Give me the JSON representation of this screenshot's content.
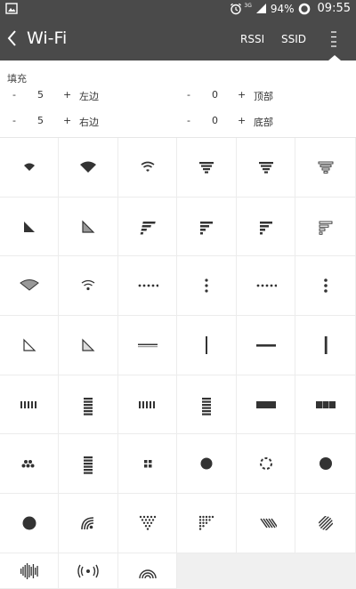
{
  "status_bar": {
    "battery_percent": "94%",
    "time": "09:55",
    "network_label": "3G"
  },
  "app_bar": {
    "title": "Wi-Fi",
    "action_rssi": "RSSI",
    "action_ssid": "SSID"
  },
  "padding": {
    "title": "填充",
    "left": {
      "minus": "-",
      "value": "5",
      "plus": "+",
      "label": "左边"
    },
    "top": {
      "minus": "-",
      "value": "0",
      "plus": "+",
      "label": "顶部"
    },
    "right": {
      "minus": "-",
      "value": "5",
      "plus": "+",
      "label": "右边"
    },
    "bottom": {
      "minus": "-",
      "value": "0",
      "plus": "+",
      "label": "底部"
    }
  },
  "styles": [
    "wifi-fan-small-icon",
    "wifi-fan-large-icon",
    "wifi-arcs-icon",
    "wifi-bars-funnel-icon",
    "wifi-bars-funnel-bold-icon",
    "wifi-bars-funnel-outline-icon",
    "signal-triangle-solid-icon",
    "signal-triangle-partial-icon",
    "signal-bars-slant-icon",
    "signal-bars-left-icon",
    "signal-bars-left-bold-icon",
    "signal-bars-left-outline-icon",
    "wifi-fan-outline-icon",
    "wifi-arcs-thin-icon",
    "dots-horizontal-icon",
    "dots-vertical-icon",
    "dots-horizontal-dark-icon",
    "dots-vertical-dark-icon",
    "signal-triangle-outline-icon",
    "signal-triangle-outline-partial-icon",
    "line-horizontal-thin-icon",
    "line-vertical-icon",
    "line-horizontal-bold-icon",
    "line-vertical-bold-icon",
    "bars-vertical-icon",
    "bars-stacked-icon",
    "bars-vertical-light-icon",
    "bars-stacked-bold-icon",
    "block-horizontal-icon",
    "block-segments-icon",
    "dots-triangle-icon",
    "bars-stacked-round-icon",
    "dots-square-icon",
    "circle-filled-icon",
    "circle-dashed-icon",
    "circle-filled-dark-icon",
    "circle-large-icon",
    "wifi-corner-arcs-icon",
    "dots-inverted-triangle-icon",
    "dots-corner-triangle-icon",
    "stripes-diagonal-icon",
    "stripes-circle-icon",
    "audio-wave-icon",
    "broadcast-icon",
    "wifi-rings-icon"
  ]
}
